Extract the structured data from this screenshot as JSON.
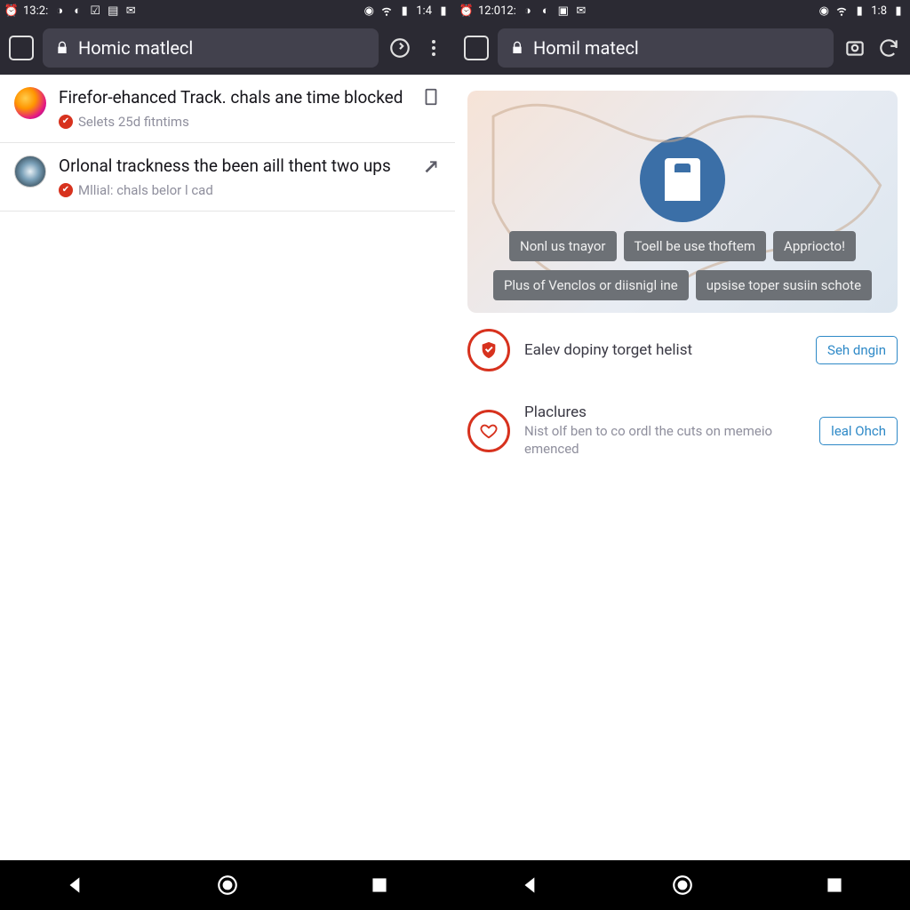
{
  "left": {
    "status": {
      "time": "13:2:",
      "battery": "1:4"
    },
    "url": "Homic matlecl",
    "feed": [
      {
        "title": "Firefor-ehanced Track. chals ane time blocked",
        "meta": "Selets 25d fitntims"
      },
      {
        "title": "Orlonal trackness the been aill thent two ups",
        "meta": "Mllial: chals belor l cad"
      }
    ]
  },
  "right": {
    "status": {
      "time": "12:012:",
      "battery": "1:8"
    },
    "url": "Homil matecl",
    "hero": {
      "chips_row1": [
        "Nonl us tnayor",
        "Toell be use thoftem",
        "Appriocto!"
      ],
      "chips_row2": [
        "Plus of Venclos or diisnigl ine",
        "upsise toper susiin schote"
      ]
    },
    "cards": [
      {
        "title": "Ealev dopiny torget helist",
        "sub": "",
        "action": "Seh dngin"
      },
      {
        "title": "Placlures",
        "sub": "Nist olf ben to co ordl the cuts on memeio emenced",
        "action": "leal Ohch"
      }
    ]
  }
}
